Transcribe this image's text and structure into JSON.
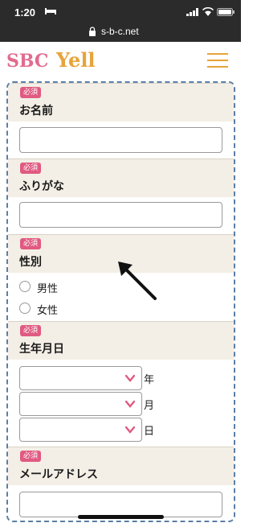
{
  "statusbar": {
    "time": "1:20"
  },
  "browser": {
    "url": "s-b-c.net"
  },
  "header": {
    "logo_sbc": "SBC",
    "logo_yell": "Yell"
  },
  "form": {
    "required_badge": "必須",
    "name": {
      "label": "お名前",
      "value": ""
    },
    "furigana": {
      "label": "ふりがな",
      "value": ""
    },
    "gender": {
      "label": "性別",
      "options": [
        "男性",
        "女性"
      ]
    },
    "birthdate": {
      "label": "生年月日",
      "units": [
        "年",
        "月",
        "日"
      ]
    },
    "email": {
      "label": "メールアドレス",
      "value": ""
    }
  },
  "colors": {
    "accent_pink": "#e05a81",
    "accent_orange": "#e8a33a",
    "dashed_border": "#5b7fa6",
    "section_bg": "#f4efe6"
  },
  "icons": [
    "bed-icon",
    "signal-icon",
    "wifi-icon",
    "battery-icon",
    "lock-icon",
    "hamburger-menu-icon",
    "chevron-down-icon",
    "arrow-annotation-icon"
  ]
}
